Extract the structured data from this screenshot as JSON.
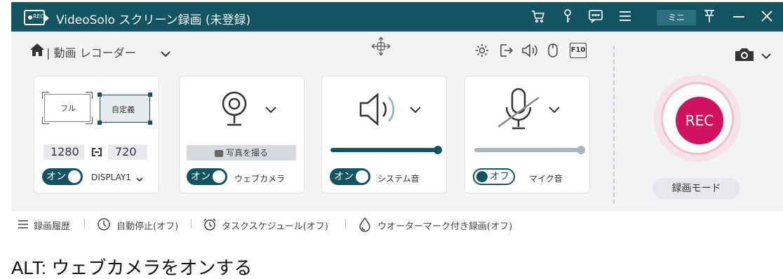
{
  "titlebar": {
    "title": "VideoSolo スクリーン録画 (未登録)",
    "mini_label": "ミニ",
    "icons": [
      "cart-icon",
      "key-icon",
      "chat-icon",
      "menu-icon",
      "pin-icon",
      "minimize-icon",
      "close-icon"
    ]
  },
  "subbar": {
    "title": "| 動画 レコーダー",
    "tools": [
      "gear-icon",
      "export-icon",
      "speaker-icon",
      "mouse-icon",
      "f10-icon"
    ],
    "f10_label": "F10"
  },
  "display_panel": {
    "full_label": "フル",
    "custom_label": "自定義",
    "width": "1280",
    "height": "720",
    "toggle_label": "オン",
    "display_name": "DISPLAY1"
  },
  "webcam_panel": {
    "photo_button": "写真を撮る",
    "toggle_label": "オン",
    "label": "ウェブカメラ"
  },
  "system_sound_panel": {
    "toggle_label": "オン",
    "label": "システム音",
    "volume": 0.98
  },
  "mic_panel": {
    "toggle_label": "オフ",
    "label": "マイク音",
    "volume": 0.98
  },
  "record": {
    "rec_label": "REC",
    "mode_label": "録画モード"
  },
  "bottom_bar": {
    "history": "録画履歴",
    "auto_stop": "自動停止(オフ)",
    "schedule": "タスクスケジュール(オフ)",
    "watermark": "ウオーターマーク付き録画(オフ)"
  },
  "alt_text": "ALT:  ウェブカメラをオンする",
  "colors": {
    "titlebar": "#145361",
    "rec": "#d2115f",
    "toggle_on": "#145361"
  }
}
